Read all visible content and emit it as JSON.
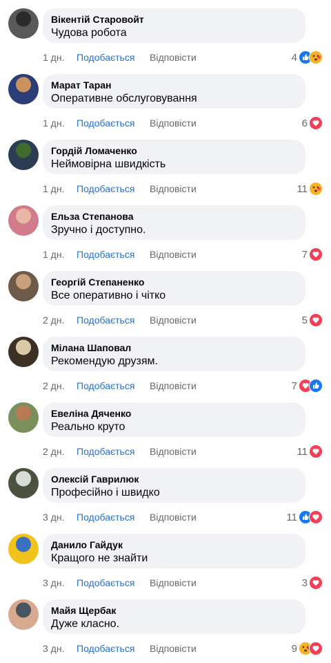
{
  "comments": [
    {
      "author": "Вікентій Старовойт",
      "text": "Чудова робота",
      "time": "1 дн.",
      "like": "Подобається",
      "reply": "Відповісти",
      "count": "4",
      "reactions": [
        "like",
        "wow-love"
      ],
      "avatar": [
        "#2b2b2b",
        "#595959"
      ]
    },
    {
      "author": "Марат Таран",
      "text": "Оперативне обслуговування",
      "time": "1 дн.",
      "like": "Подобається",
      "reply": "Відповісти",
      "count": "6",
      "reactions": [
        "love"
      ],
      "avatar": [
        "#c9925f",
        "#2c3e78"
      ]
    },
    {
      "author": "Гордій Ломаченко",
      "text": "Неймовірна швидкість",
      "time": "1 дн.",
      "like": "Подобається",
      "reply": "Відповісти",
      "count": "11",
      "reactions": [
        "wow-love"
      ],
      "avatar": [
        "#3f6b2d",
        "#2a3d52"
      ]
    },
    {
      "author": "Ельза Степанова",
      "text": "Зручно і доступно.",
      "time": "1 дн.",
      "like": "Подобається",
      "reply": "Відповісти",
      "count": "7",
      "reactions": [
        "love"
      ],
      "avatar": [
        "#e9b7a6",
        "#d27b8a"
      ]
    },
    {
      "author": "Георгій Степаненко",
      "text": "Все оперативно і чітко",
      "time": "2 дн.",
      "like": "Подобається",
      "reply": "Відповісти",
      "count": "5",
      "reactions": [
        "love"
      ],
      "avatar": [
        "#c9a27d",
        "#6e5a48"
      ]
    },
    {
      "author": "Мілана Шаповал",
      "text": "Рекомендую друзям.",
      "time": "2 дн.",
      "like": "Подобається",
      "reply": "Відповісти",
      "count": "7",
      "reactions": [
        "love",
        "like"
      ],
      "avatar": [
        "#d9c9a7",
        "#3d3125"
      ]
    },
    {
      "author": "Евеліна Дяченко",
      "text": "Реально круто",
      "time": "2 дн.",
      "like": "Подобається",
      "reply": "Відповісти",
      "count": "11",
      "reactions": [
        "love"
      ],
      "avatar": [
        "#b77a55",
        "#7a8f5b"
      ]
    },
    {
      "author": "Олексій Гаврилюк",
      "text": "Професійно і швидко",
      "time": "3 дн.",
      "like": "Подобається",
      "reply": "Відповісти",
      "count": "11",
      "reactions": [
        "like",
        "love"
      ],
      "avatar": [
        "#d8dcd6",
        "#4b5340"
      ]
    },
    {
      "author": "Данило Гайдук",
      "text": "Кращого не знайти",
      "time": "3 дн.",
      "like": "Подобається",
      "reply": "Відповісти",
      "count": "3",
      "reactions": [
        "love"
      ],
      "avatar": [
        "#3b6fbf",
        "#f2c31a"
      ]
    },
    {
      "author": "Майя Щербак",
      "text": "Дуже класно.",
      "time": "3 дн.",
      "like": "Подобається",
      "reply": "Відповісти",
      "count": "9",
      "reactions": [
        "wow-love",
        "love"
      ],
      "avatar": [
        "#46555f",
        "#d8a98f"
      ]
    }
  ]
}
